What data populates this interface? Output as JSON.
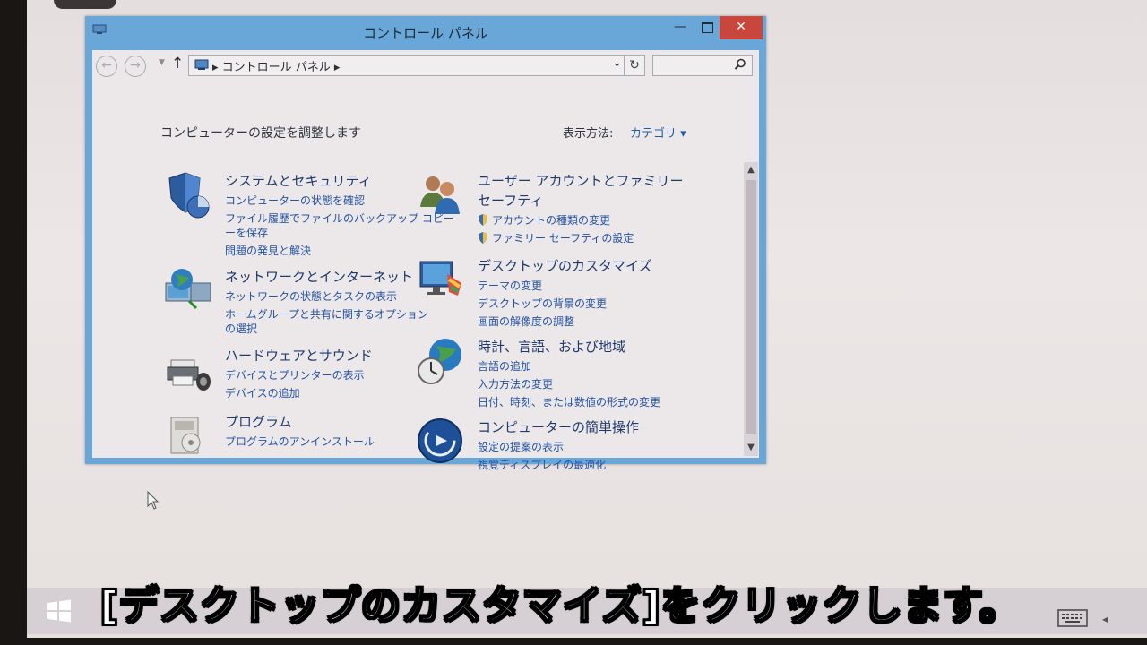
{
  "window": {
    "title": "コントロール パネル",
    "controls": {
      "minimize": "—",
      "close": "✕"
    }
  },
  "nav": {
    "back": "←",
    "forward": "→",
    "up": "↑",
    "address_path": "▸ コントロール パネル ▸",
    "dropdown": "⌄",
    "refresh": "↻",
    "search_placeholder": ""
  },
  "content": {
    "heading": "コンピューターの設定を調整します",
    "view_label": "表示方法:",
    "view_value": "カテゴリ ▾",
    "categories": [
      {
        "title": "システムとセキュリティ",
        "icon": "shield-icon",
        "links": [
          "コンピューターの状態を確認",
          "ファイル履歴でファイルのバックアップ コピー",
          "ーを保存",
          "問題の発見と解決"
        ]
      },
      {
        "title": "ネットワークとインターネット",
        "icon": "network-globe-icon",
        "links": [
          "ネットワークの状態とタスクの表示",
          "ホームグループと共有に関するオプション",
          "の選択"
        ]
      },
      {
        "title": "ハードウェアとサウンド",
        "icon": "printer-icon",
        "links": [
          "デバイスとプリンターの表示",
          "デバイスの追加"
        ]
      },
      {
        "title": "プログラム",
        "icon": "programs-icon",
        "links": [
          "プログラムのアンインストール"
        ]
      },
      {
        "title": "ユーザー アカウントとファミリー",
        "title2": "セーフティ",
        "icon": "users-icon",
        "links": [
          "アカウントの種類の変更",
          "ファミリー セーフティの設定"
        ]
      },
      {
        "title": "デスクトップのカスタマイズ",
        "icon": "desktop-customize-icon",
        "links": [
          "テーマの変更",
          "デスクトップの背景の変更",
          "画面の解像度の調整"
        ]
      },
      {
        "title": "時計、言語、および地域",
        "icon": "clock-globe-icon",
        "links": [
          "言語の追加",
          "入力方法の変更",
          "日付、時刻、または数値の形式の変更"
        ]
      },
      {
        "title": "コンピューターの簡単操作",
        "icon": "ease-of-access-icon",
        "links": [
          "設定の提案の表示",
          "視覚ディスプレイの最適化"
        ]
      }
    ]
  },
  "caption": "[デスクトップのカスタマイズ]をクリックします。",
  "colors": {
    "titlebar": "#6aa7d9",
    "close": "#c9463d",
    "link": "#2453a0"
  }
}
